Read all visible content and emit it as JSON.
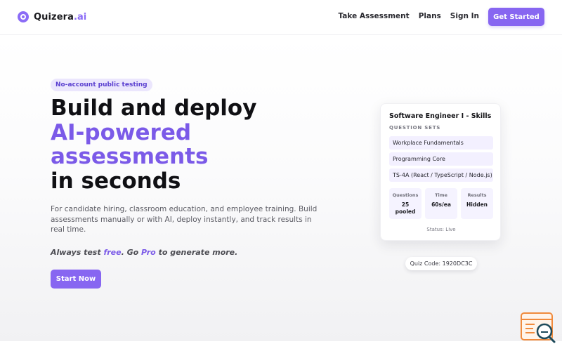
{
  "brand": {
    "name": "Quizera",
    "suffix": ".ai"
  },
  "nav": {
    "links": [
      "Take Assessment",
      "Plans",
      "Sign In"
    ],
    "cta_label": "Get Started"
  },
  "hero": {
    "badge": "No-account public testing",
    "headline_line1": "Build and deploy",
    "headline_accent1": "AI-powered",
    "headline_accent2": "assessments",
    "headline_line2": "in seconds",
    "description": "For candidate hiring, classroom education, and employee training. Build assessments manually or with AI, deploy instantly, and track results in real time.",
    "tagline": {
      "part1": "Always test ",
      "free": "free",
      "part2": ". Go ",
      "pro": "Pro",
      "part3": " to generate more."
    },
    "start_label": "Start Now"
  },
  "card": {
    "title": "Software Engineer I - Skills",
    "subtitle": "QUESTION SETS",
    "question_sets": [
      "Workplace Fundamentals",
      "Programming Core",
      "TS-4A (React / TypeScript / Node.js)"
    ],
    "stats": [
      {
        "label": "Questions",
        "value_line1": "25",
        "value_line2": "pooled"
      },
      {
        "label": "Time",
        "value_line1": "60s/ea",
        "value_line2": ""
      },
      {
        "label": "Results",
        "value_line1": "Hidden",
        "value_line2": ""
      }
    ],
    "status": "Status: Live"
  },
  "quiz_code": "Quiz Code: 1920DC3C",
  "colors": {
    "accent": "#8766f1",
    "accent_text": "#7b5ae8",
    "badge_bg": "#ebe6fd",
    "card_tint": "#f3f0ff"
  }
}
